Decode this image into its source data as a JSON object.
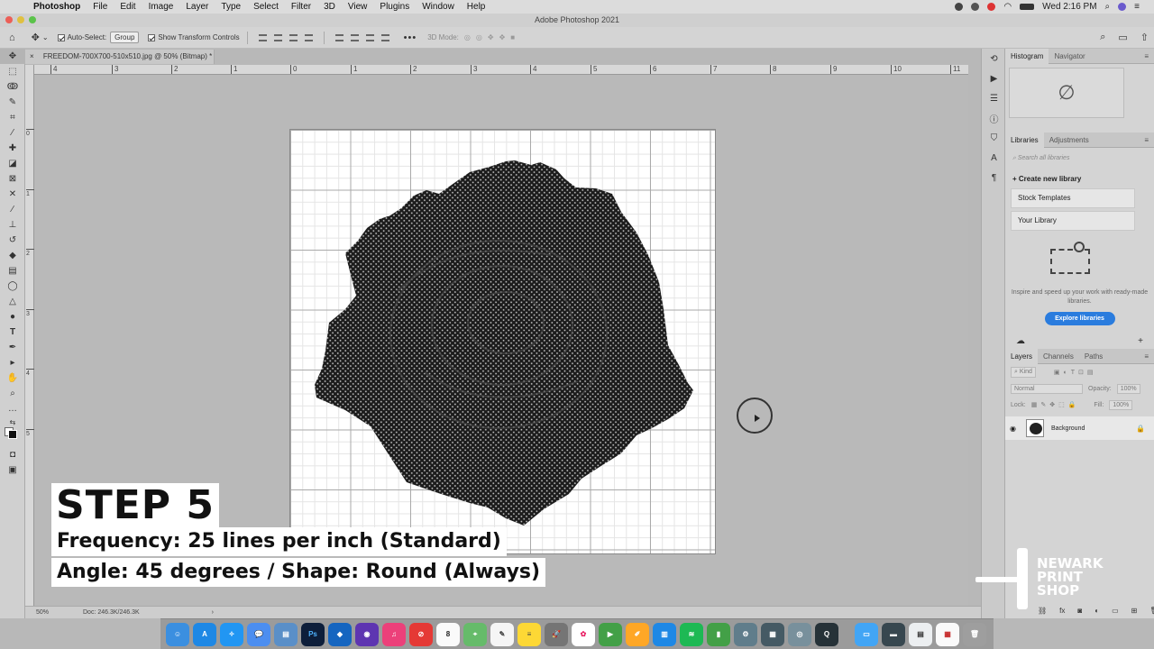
{
  "menubar": {
    "app": "Photoshop",
    "items": [
      "File",
      "Edit",
      "Image",
      "Layer",
      "Type",
      "Select",
      "Filter",
      "3D",
      "View",
      "Plugins",
      "Window",
      "Help"
    ],
    "clock": "Wed 2:16 PM"
  },
  "window": {
    "title": "Adobe Photoshop 2021"
  },
  "options_bar": {
    "auto_select_label": "Auto-Select:",
    "auto_select_value": "Group",
    "show_transform_label": "Show Transform Controls",
    "mode_3d_label": "3D Mode:"
  },
  "document": {
    "tab_title": "FREEDOM-700X700-510x510.jpg @ 50% (Bitmap) *",
    "zoom": "50%",
    "doc_size": "Doc: 246.3K/246.3K"
  },
  "rulers": {
    "top": [
      "4",
      "3",
      "2",
      "1",
      "0",
      "1",
      "2",
      "3",
      "4",
      "5",
      "6",
      "7",
      "8",
      "9",
      "10",
      "11"
    ],
    "left": [
      "0",
      "1",
      "2",
      "3",
      "4",
      "5"
    ]
  },
  "overlay": {
    "step": "STEP 5",
    "line1": "Frequency: 25 lines per inch (Standard)",
    "line2": "Angle: 45 degrees / Shape: Round (Always)"
  },
  "panels": {
    "top_tabs": [
      "Histogram",
      "Navigator"
    ],
    "lib_tabs": [
      "Libraries",
      "Adjustments"
    ],
    "lib_search_placeholder": "Search all libraries",
    "create_new": "Create new library",
    "stock_templates": "Stock Templates",
    "your_library": "Your Library",
    "lib_info": "Inspire and speed up your work with ready-made libraries.",
    "explore": "Explore libraries",
    "layer_tabs": [
      "Layers",
      "Channels",
      "Paths"
    ],
    "kind_label": "Kind",
    "blend_mode": "Normal",
    "opacity_label": "Opacity:",
    "opacity_value": "100%",
    "lock_label": "Lock:",
    "fill_label": "Fill:",
    "fill_value": "100%",
    "layer_name": "Background"
  },
  "logo": {
    "line1": "NEWARK",
    "line2": "PRINT",
    "line3": "SHOP"
  },
  "icons": {
    "histogram_empty": "∅"
  }
}
